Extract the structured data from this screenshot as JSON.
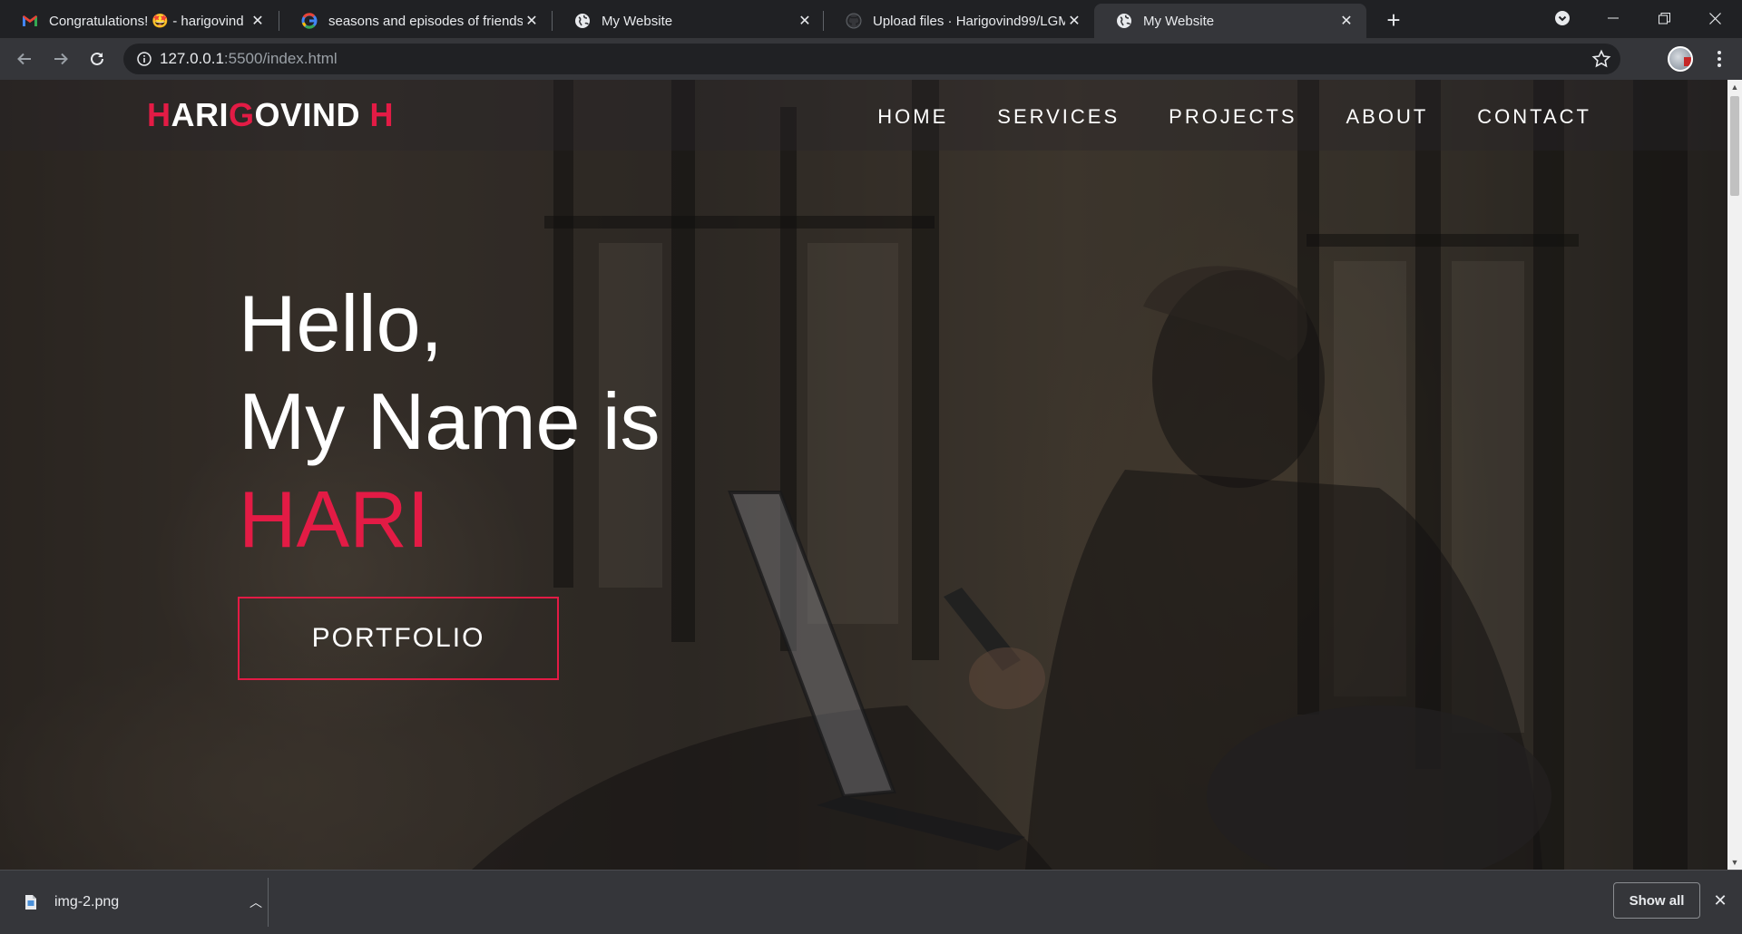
{
  "browser": {
    "tabs": [
      {
        "title": "Congratulations! 🤩 - harigovind",
        "icon": "gmail-icon"
      },
      {
        "title": "seasons and episodes of friends -",
        "icon": "google-icon"
      },
      {
        "title": "My Website",
        "icon": "globe-icon"
      },
      {
        "title": "Upload files · Harigovind99/LGM",
        "icon": "github-icon"
      },
      {
        "title": "My Website",
        "icon": "globe-icon",
        "active": true
      }
    ],
    "url_host": "127.0.0.1",
    "url_path": ":5500/index.html"
  },
  "site": {
    "logo": {
      "h": "H",
      "ari": "ARI",
      "g": "G",
      "ovind": "OVIND ",
      "h2": "H"
    },
    "nav": [
      "HOME",
      "SERVICES",
      "PROJECTS",
      "ABOUT",
      "CONTACT"
    ],
    "hero": {
      "line1": "Hello,",
      "line2": "My Name is",
      "name": "HARI",
      "button": "PORTFOLIO"
    }
  },
  "downloads": {
    "file": "img-2.png",
    "show_all": "Show all"
  },
  "colors": {
    "accent": "#e31b45",
    "chrome_dark": "#202124",
    "chrome": "#35363a"
  }
}
